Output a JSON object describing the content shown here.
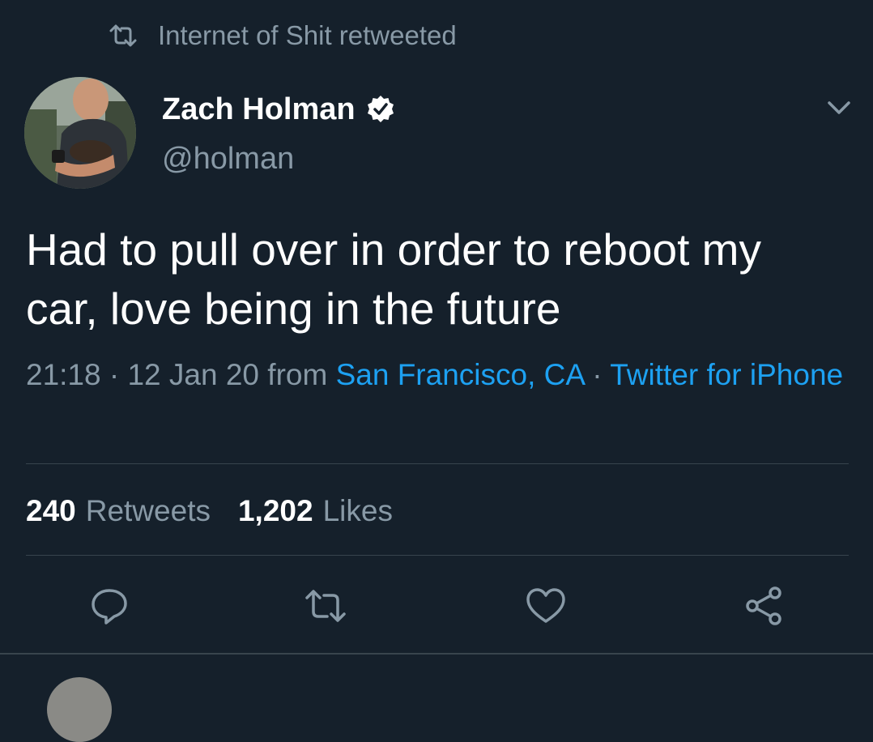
{
  "retweet_context": {
    "icon": "retweet-icon",
    "text": "Internet of Shit retweeted"
  },
  "author": {
    "display_name": "Zach Holman",
    "handle": "@holman",
    "verified": true,
    "verified_icon": "verified-badge-icon"
  },
  "menu_icon": "chevron-down-icon",
  "tweet": {
    "text_line1": "Had to pull over in order to reboot my",
    "text_line2": "car, love being in the future"
  },
  "meta": {
    "time": "21:18",
    "sep1": " · ",
    "date": "12 Jan 20",
    "from_word": " from ",
    "location": "San Francisco, CA",
    "sep2": " · ",
    "source": "Twitter for iPhone"
  },
  "stats": {
    "retweets_count": "240",
    "retweets_label": "Retweets",
    "likes_count": "1,202",
    "likes_label": "Likes"
  },
  "actions": [
    "reply-icon",
    "retweet-icon",
    "like-icon",
    "share-icon"
  ],
  "colors": {
    "background": "#15202b",
    "accent": "#1da1f2",
    "muted": "#8899a6",
    "divider": "#38444d"
  }
}
